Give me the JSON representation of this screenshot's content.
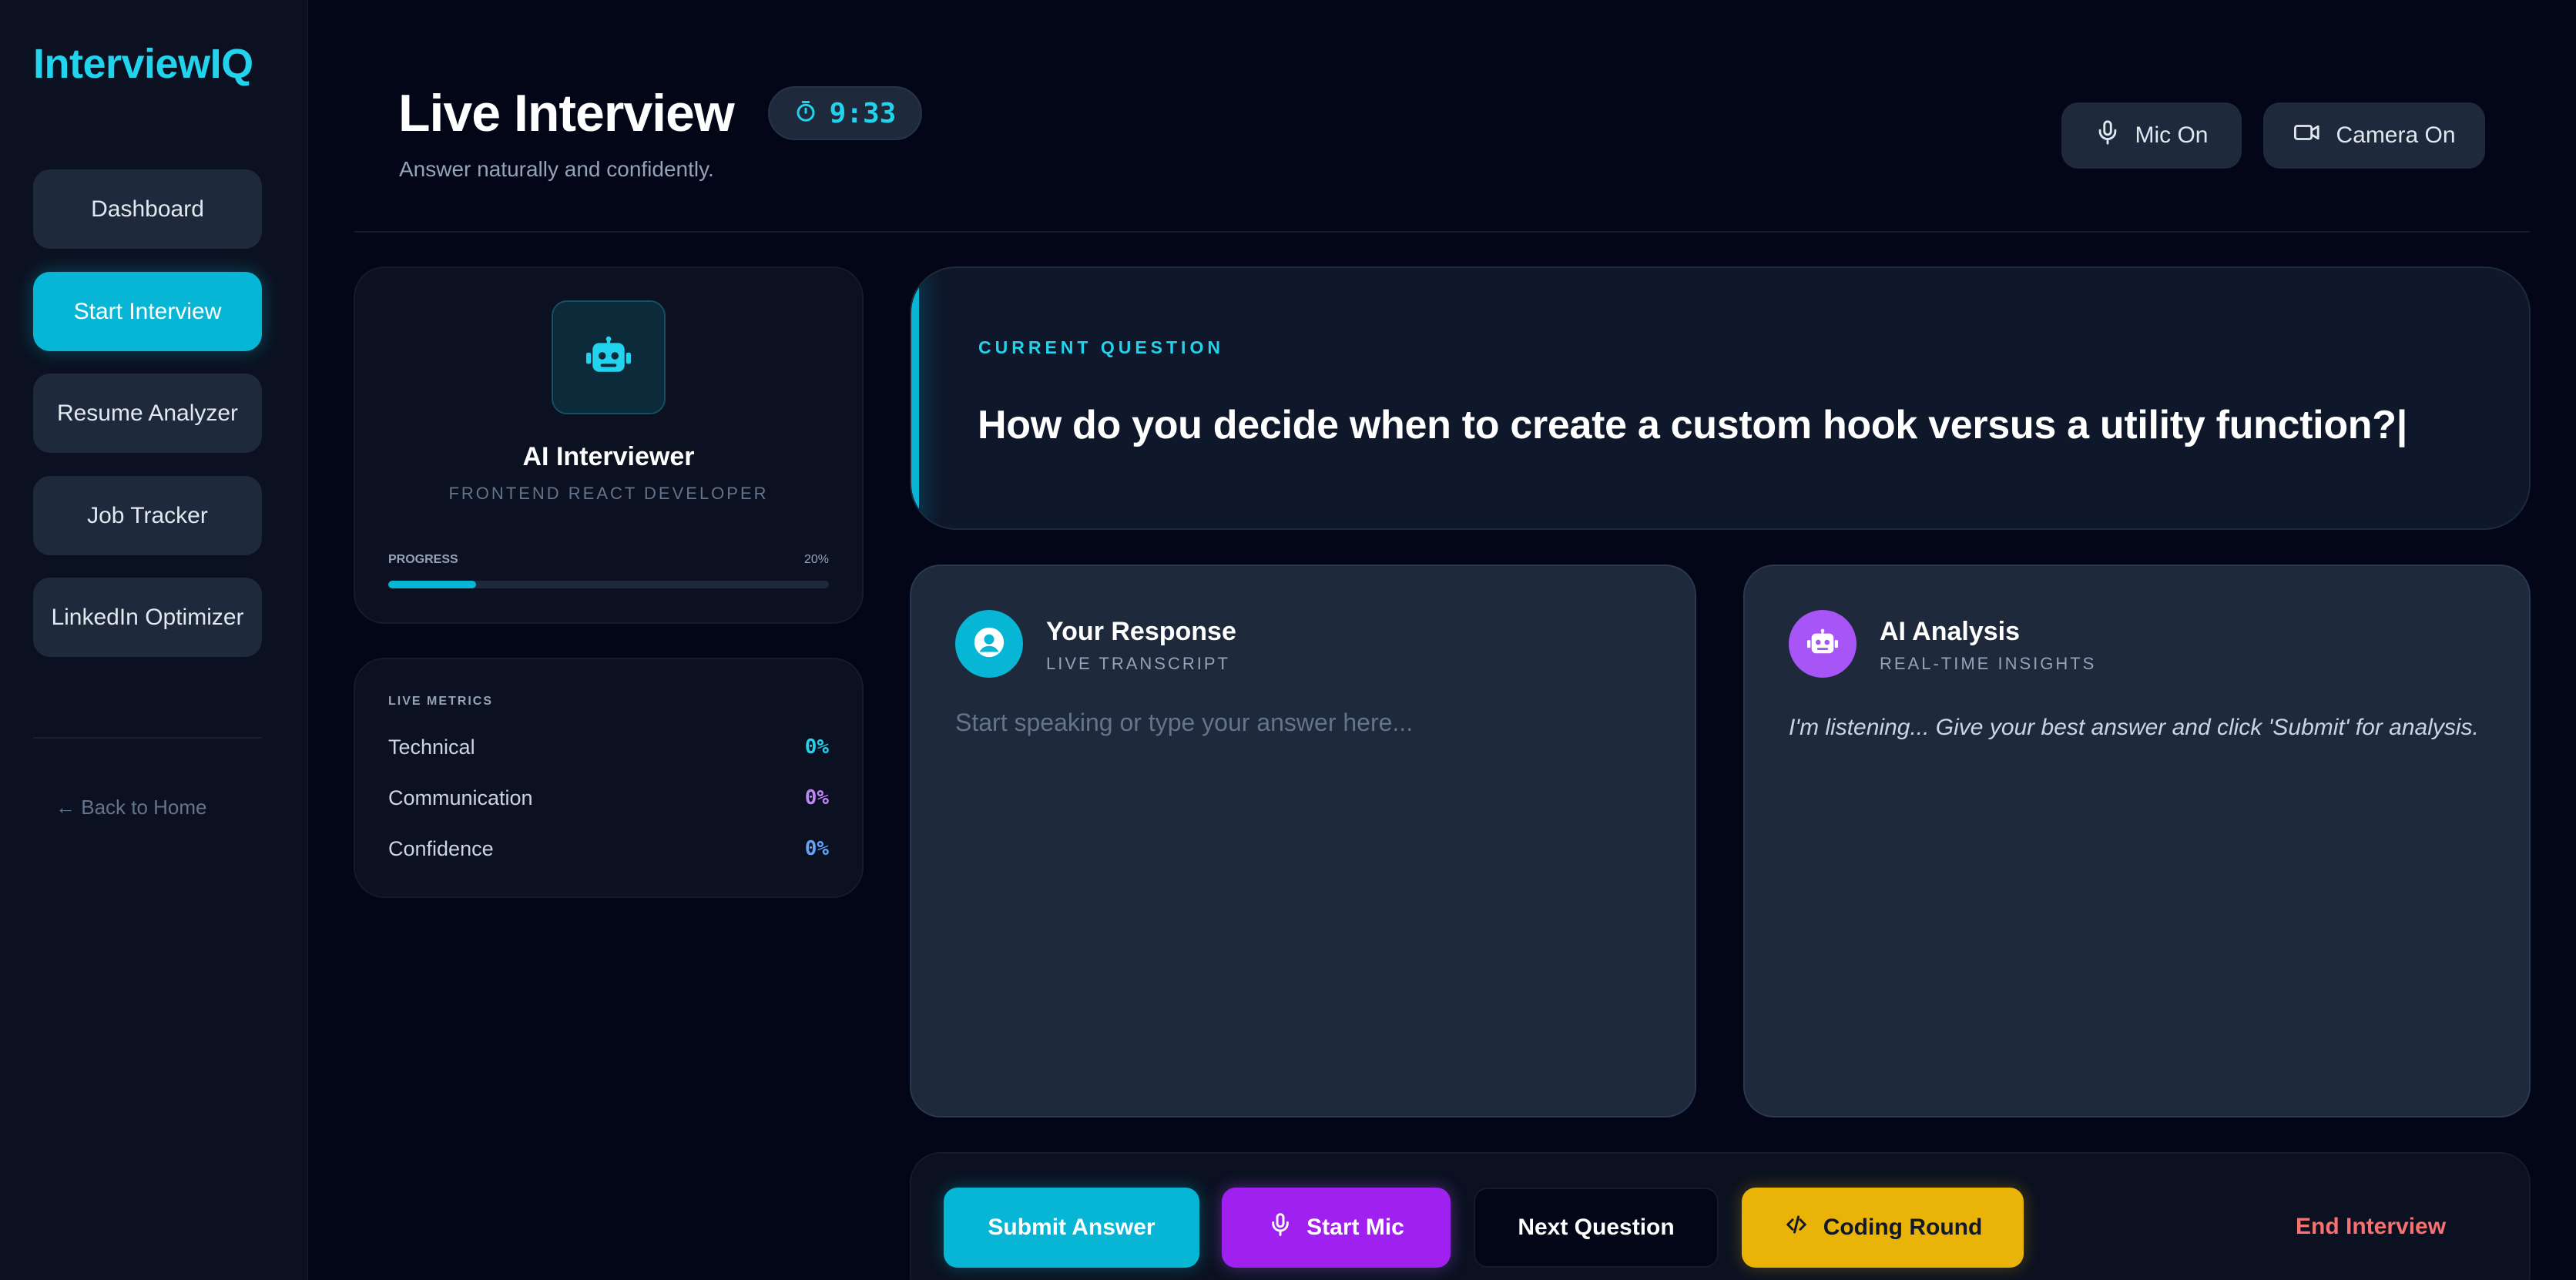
{
  "brand": "InterviewIQ",
  "sidebar": {
    "items": [
      {
        "label": "Dashboard"
      },
      {
        "label": "Start Interview"
      },
      {
        "label": "Resume Analyzer"
      },
      {
        "label": "Job Tracker"
      },
      {
        "label": "LinkedIn Optimizer"
      }
    ],
    "back_link": "← Back to Home"
  },
  "header": {
    "title": "Live Interview",
    "timer": "9:33",
    "subtitle": "Answer naturally and confidently.",
    "mic_label": "Mic On",
    "camera_label": "Camera On"
  },
  "interviewer": {
    "name": "AI Interviewer",
    "role": "FRONTEND REACT DEVELOPER",
    "progress_label": "PROGRESS",
    "progress_text": "20%",
    "progress_fraction": 0.2
  },
  "metrics": {
    "title": "LIVE METRICS",
    "items": [
      {
        "label": "Technical",
        "value": "0%",
        "color": "#22d3ee"
      },
      {
        "label": "Communication",
        "value": "0%",
        "color": "#c084fc"
      },
      {
        "label": "Confidence",
        "value": "0%",
        "color": "#60a5fa"
      }
    ]
  },
  "question": {
    "label": "CURRENT QUESTION",
    "text": "How do you decide when to create a custom hook versus a utility function?|"
  },
  "response": {
    "title": "Your Response",
    "subtitle": "LIVE TRANSCRIPT",
    "placeholder": "Start speaking or type your answer here..."
  },
  "analysis": {
    "title": "AI Analysis",
    "subtitle": "REAL-TIME INSIGHTS",
    "text": "I'm listening... Give your best answer and click 'Submit' for analysis."
  },
  "actions": {
    "submit": "Submit Answer",
    "start_mic": "Start Mic",
    "next": "Next Question",
    "coding": "Coding Round",
    "end": "End Interview"
  },
  "colors": {
    "accent": "#06b6d4",
    "purple": "#a855f7",
    "amber": "#eab308",
    "danger": "#f87171"
  }
}
